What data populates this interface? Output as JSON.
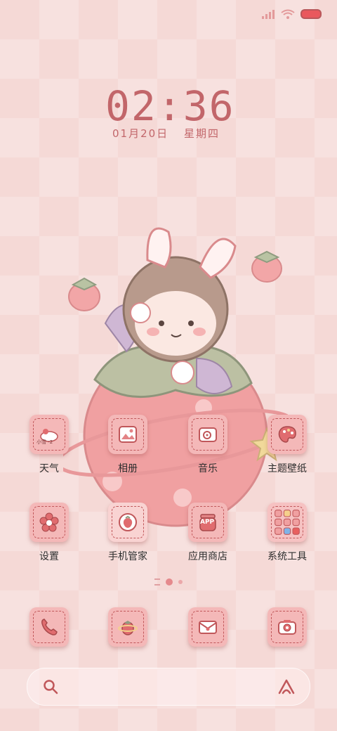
{
  "status_bar": {
    "icons": [
      "signal-icon",
      "wifi-icon",
      "battery-icon"
    ]
  },
  "clock": {
    "time": "02:36",
    "date": "01月20日",
    "weekday": "星期四"
  },
  "apps": [
    {
      "label": "天气",
      "icon": "weather-cloud-icon",
      "icon_text": "小雪 -2"
    },
    {
      "label": "相册",
      "icon": "photo-icon"
    },
    {
      "label": "音乐",
      "icon": "music-icon"
    },
    {
      "label": "主题壁纸",
      "icon": "palette-icon"
    },
    {
      "label": "设置",
      "icon": "flower-gear-icon"
    },
    {
      "label": "手机管家",
      "icon": "strawberry-shield-icon"
    },
    {
      "label": "应用商店",
      "icon": "app-jar-icon",
      "icon_text": "APP"
    },
    {
      "label": "系统工具",
      "icon": "folder-grid-icon"
    }
  ],
  "dock": [
    {
      "icon": "phone-icon"
    },
    {
      "icon": "strawberry-planet-icon"
    },
    {
      "icon": "envelope-icon"
    },
    {
      "icon": "camera-icon"
    }
  ],
  "page_indicator": {
    "pages": 2,
    "active": 0
  },
  "colors": {
    "accent": "#c2666a",
    "icon_bg": "#f4b8b8",
    "background": "#f5d9d6"
  }
}
